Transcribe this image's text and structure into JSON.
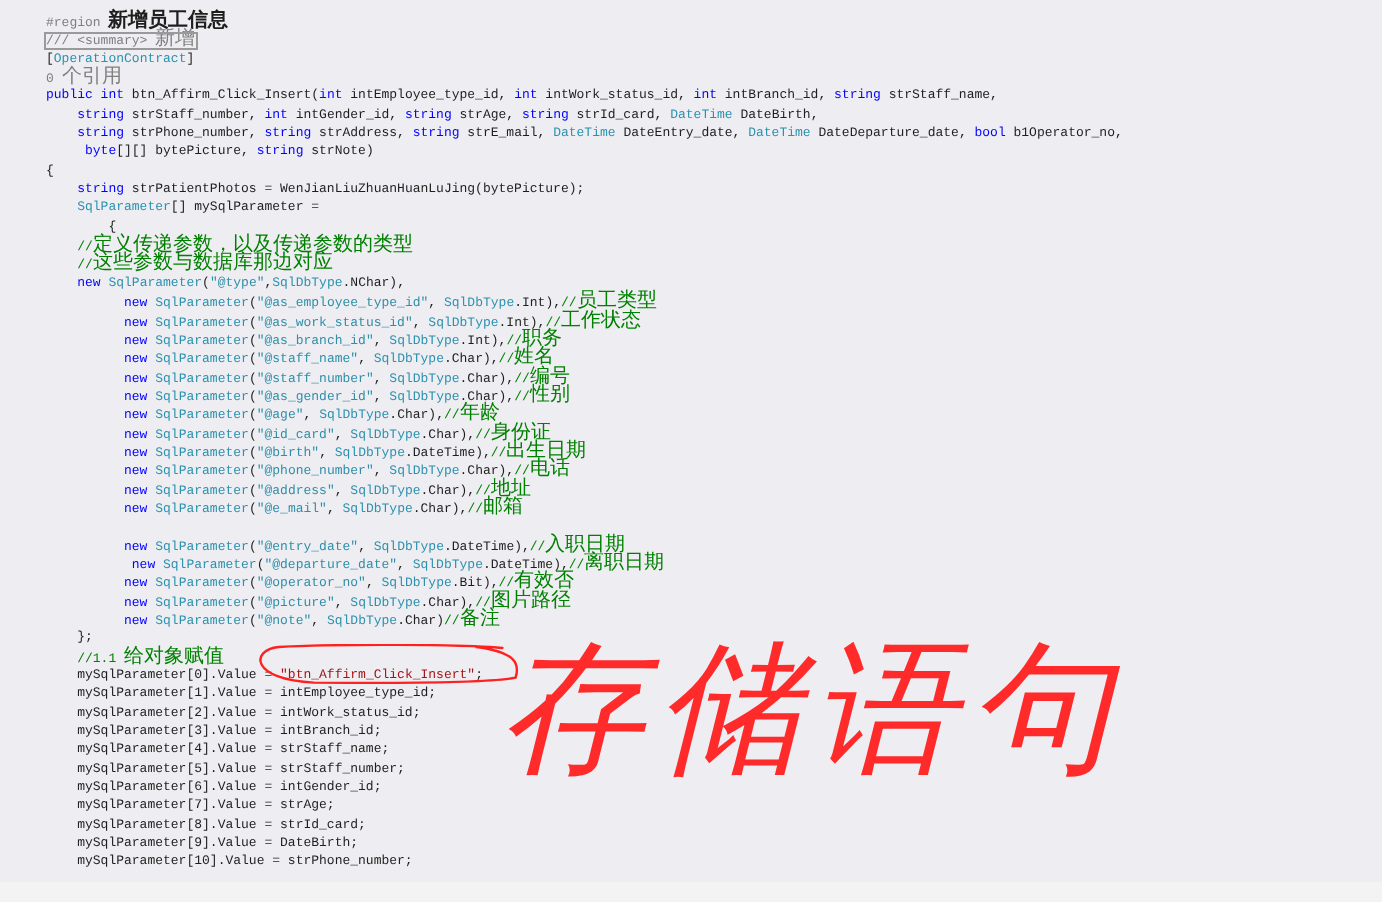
{
  "editor": {
    "lines": [
      {
        "kind": "code",
        "segments": [
          {
            "kind": "gray",
            "text": "#region"
          },
          {
            "kind": "region",
            "text": " 新增员工信息"
          }
        ]
      },
      {
        "kind": "code",
        "segments": [
          {
            "kind": "doc",
            "text": "/// <summary> 新增"
          }
        ]
      },
      {
        "kind": "code",
        "segments": [
          {
            "kind": "plain",
            "text": "["
          },
          {
            "kind": "type",
            "text": "OperationContract"
          },
          {
            "kind": "plain",
            "text": "]"
          }
        ]
      },
      {
        "kind": "code",
        "segments": [
          {
            "kind": "gray",
            "text": "0 个引用"
          }
        ]
      },
      {
        "kind": "code",
        "segments": [
          {
            "kind": "kw",
            "text": "public int"
          },
          {
            "kind": "plain",
            "text": " btn_Affirm_Click_Insert("
          },
          {
            "kind": "kw",
            "text": "int"
          },
          {
            "kind": "plain",
            "text": " intEmployee_type_id, "
          },
          {
            "kind": "kw",
            "text": "int"
          },
          {
            "kind": "plain",
            "text": " intWork_status_id, "
          },
          {
            "kind": "kw",
            "text": "int"
          },
          {
            "kind": "plain",
            "text": " intBranch_id, "
          },
          {
            "kind": "kw",
            "text": "string"
          },
          {
            "kind": "plain",
            "text": " strStaff_name,"
          }
        ]
      },
      {
        "kind": "code",
        "segments": [
          {
            "kind": "kw",
            "text": "    string"
          },
          {
            "kind": "plain",
            "text": " strStaff_number, "
          },
          {
            "kind": "kw",
            "text": "int"
          },
          {
            "kind": "plain",
            "text": " intGender_id, "
          },
          {
            "kind": "kw",
            "text": "string"
          },
          {
            "kind": "plain",
            "text": " strAge, "
          },
          {
            "kind": "kw",
            "text": "string"
          },
          {
            "kind": "plain",
            "text": " strId_card, "
          },
          {
            "kind": "type",
            "text": "DateTime"
          },
          {
            "kind": "plain",
            "text": " DateBirth,"
          }
        ]
      },
      {
        "kind": "code",
        "segments": [
          {
            "kind": "kw",
            "text": "    string"
          },
          {
            "kind": "plain",
            "text": " strPhone_number, "
          },
          {
            "kind": "kw",
            "text": "string"
          },
          {
            "kind": "plain",
            "text": " strAddress, "
          },
          {
            "kind": "kw",
            "text": "string"
          },
          {
            "kind": "plain",
            "text": " strE_mail, "
          },
          {
            "kind": "type",
            "text": "DateTime"
          },
          {
            "kind": "plain",
            "text": " DateEntry_date, "
          },
          {
            "kind": "type",
            "text": "DateTime"
          },
          {
            "kind": "plain",
            "text": " DateDeparture_date, "
          },
          {
            "kind": "kw",
            "text": "bool"
          },
          {
            "kind": "plain",
            "text": " b1Operator_no,"
          }
        ]
      },
      {
        "kind": "code",
        "segments": [
          {
            "kind": "kw",
            "text": "     byte"
          },
          {
            "kind": "plain",
            "text": "[][] bytePicture, "
          },
          {
            "kind": "kw",
            "text": "string"
          },
          {
            "kind": "plain",
            "text": " strNote)"
          }
        ]
      },
      {
        "kind": "code",
        "segments": [
          {
            "kind": "plain",
            "text": "{"
          }
        ]
      },
      {
        "kind": "code",
        "segments": [
          {
            "kind": "kw",
            "text": "    string"
          },
          {
            "kind": "plain",
            "text": " strPatientPhotos = WenJianLiuZhuanHuanLuJing(bytePicture);"
          }
        ]
      },
      {
        "kind": "code",
        "segments": [
          {
            "kind": "type",
            "text": "    SqlParameter"
          },
          {
            "kind": "plain",
            "text": "[] mySqlParameter ="
          }
        ]
      },
      {
        "kind": "code",
        "segments": [
          {
            "kind": "plain",
            "text": "        {"
          }
        ]
      },
      {
        "kind": "code",
        "segments": [
          {
            "kind": "comment",
            "text": "    //定义传递参数，以及传递参数的类型"
          }
        ]
      },
      {
        "kind": "code",
        "segments": [
          {
            "kind": "comment",
            "text": "    //这些参数与数据库那边对应"
          }
        ]
      },
      {
        "kind": "code",
        "segments": [
          {
            "kind": "kw",
            "text": "    new"
          },
          {
            "kind": "type",
            "text": " SqlParameter"
          },
          {
            "kind": "plain",
            "text": "("
          },
          {
            "kind": "param",
            "text": "\"@type\""
          },
          {
            "kind": "plain",
            "text": ","
          },
          {
            "kind": "type",
            "text": "SqlDbType"
          },
          {
            "kind": "plain",
            "text": ".NChar),"
          }
        ]
      },
      {
        "kind": "code",
        "segments": [
          {
            "kind": "kw",
            "text": "          new"
          },
          {
            "kind": "type",
            "text": " SqlParameter"
          },
          {
            "kind": "plain",
            "text": "("
          },
          {
            "kind": "param",
            "text": "\"@as_employee_type_id\""
          },
          {
            "kind": "plain",
            "text": ", "
          },
          {
            "kind": "type",
            "text": "SqlDbType"
          },
          {
            "kind": "plain",
            "text": ".Int),"
          },
          {
            "kind": "comment",
            "text": "//员工类型"
          }
        ]
      },
      {
        "kind": "code",
        "segments": [
          {
            "kind": "kw",
            "text": "          new"
          },
          {
            "kind": "type",
            "text": " SqlParameter"
          },
          {
            "kind": "plain",
            "text": "("
          },
          {
            "kind": "param",
            "text": "\"@as_work_status_id\""
          },
          {
            "kind": "plain",
            "text": ", "
          },
          {
            "kind": "type",
            "text": "SqlDbType"
          },
          {
            "kind": "plain",
            "text": ".Int),"
          },
          {
            "kind": "comment",
            "text": "//工作状态"
          }
        ]
      },
      {
        "kind": "code",
        "segments": [
          {
            "kind": "kw",
            "text": "          new"
          },
          {
            "kind": "type",
            "text": " SqlParameter"
          },
          {
            "kind": "plain",
            "text": "("
          },
          {
            "kind": "param",
            "text": "\"@as_branch_id\""
          },
          {
            "kind": "plain",
            "text": ", "
          },
          {
            "kind": "type",
            "text": "SqlDbType"
          },
          {
            "kind": "plain",
            "text": ".Int),"
          },
          {
            "kind": "comment",
            "text": "//职务"
          }
        ]
      },
      {
        "kind": "code",
        "segments": [
          {
            "kind": "kw",
            "text": "          new"
          },
          {
            "kind": "type",
            "text": " SqlParameter"
          },
          {
            "kind": "plain",
            "text": "("
          },
          {
            "kind": "param",
            "text": "\"@staff_name\""
          },
          {
            "kind": "plain",
            "text": ", "
          },
          {
            "kind": "type",
            "text": "SqlDbType"
          },
          {
            "kind": "plain",
            "text": ".Char),"
          },
          {
            "kind": "comment",
            "text": "//姓名"
          }
        ]
      },
      {
        "kind": "code",
        "segments": [
          {
            "kind": "kw",
            "text": "          new"
          },
          {
            "kind": "type",
            "text": " SqlParameter"
          },
          {
            "kind": "plain",
            "text": "("
          },
          {
            "kind": "param",
            "text": "\"@staff_number\""
          },
          {
            "kind": "plain",
            "text": ", "
          },
          {
            "kind": "type",
            "text": "SqlDbType"
          },
          {
            "kind": "plain",
            "text": ".Char),"
          },
          {
            "kind": "comment",
            "text": "//编号"
          }
        ]
      },
      {
        "kind": "code",
        "segments": [
          {
            "kind": "kw",
            "text": "          new"
          },
          {
            "kind": "type",
            "text": " SqlParameter"
          },
          {
            "kind": "plain",
            "text": "("
          },
          {
            "kind": "param",
            "text": "\"@as_gender_id\""
          },
          {
            "kind": "plain",
            "text": ", "
          },
          {
            "kind": "type",
            "text": "SqlDbType"
          },
          {
            "kind": "plain",
            "text": ".Char),"
          },
          {
            "kind": "comment",
            "text": "//性别"
          }
        ]
      },
      {
        "kind": "code",
        "segments": [
          {
            "kind": "kw",
            "text": "          new"
          },
          {
            "kind": "type",
            "text": " SqlParameter"
          },
          {
            "kind": "plain",
            "text": "("
          },
          {
            "kind": "param",
            "text": "\"@age\""
          },
          {
            "kind": "plain",
            "text": ", "
          },
          {
            "kind": "type",
            "text": "SqlDbType"
          },
          {
            "kind": "plain",
            "text": ".Char),"
          },
          {
            "kind": "comment",
            "text": "//年龄"
          }
        ]
      },
      {
        "kind": "code",
        "segments": [
          {
            "kind": "kw",
            "text": "          new"
          },
          {
            "kind": "type",
            "text": " SqlParameter"
          },
          {
            "kind": "plain",
            "text": "("
          },
          {
            "kind": "param",
            "text": "\"@id_card\""
          },
          {
            "kind": "plain",
            "text": ", "
          },
          {
            "kind": "type",
            "text": "SqlDbType"
          },
          {
            "kind": "plain",
            "text": ".Char),"
          },
          {
            "kind": "comment",
            "text": "//身份证"
          }
        ]
      },
      {
        "kind": "code",
        "segments": [
          {
            "kind": "kw",
            "text": "          new"
          },
          {
            "kind": "type",
            "text": " SqlParameter"
          },
          {
            "kind": "plain",
            "text": "("
          },
          {
            "kind": "param",
            "text": "\"@birth\""
          },
          {
            "kind": "plain",
            "text": ", "
          },
          {
            "kind": "type",
            "text": "SqlDbType"
          },
          {
            "kind": "plain",
            "text": ".DateTime),"
          },
          {
            "kind": "comment",
            "text": "//出生日期"
          }
        ]
      },
      {
        "kind": "code",
        "segments": [
          {
            "kind": "kw",
            "text": "          new"
          },
          {
            "kind": "type",
            "text": " SqlParameter"
          },
          {
            "kind": "plain",
            "text": "("
          },
          {
            "kind": "param",
            "text": "\"@phone_number\""
          },
          {
            "kind": "plain",
            "text": ", "
          },
          {
            "kind": "type",
            "text": "SqlDbType"
          },
          {
            "kind": "plain",
            "text": ".Char),"
          },
          {
            "kind": "comment",
            "text": "//电话"
          }
        ]
      },
      {
        "kind": "code",
        "segments": [
          {
            "kind": "kw",
            "text": "          new"
          },
          {
            "kind": "type",
            "text": " SqlParameter"
          },
          {
            "kind": "plain",
            "text": "("
          },
          {
            "kind": "param",
            "text": "\"@address\""
          },
          {
            "kind": "plain",
            "text": ", "
          },
          {
            "kind": "type",
            "text": "SqlDbType"
          },
          {
            "kind": "plain",
            "text": ".Char),"
          },
          {
            "kind": "comment",
            "text": "//地址"
          }
        ]
      },
      {
        "kind": "code",
        "segments": [
          {
            "kind": "kw",
            "text": "          new"
          },
          {
            "kind": "type",
            "text": " SqlParameter"
          },
          {
            "kind": "plain",
            "text": "("
          },
          {
            "kind": "param",
            "text": "\"@e_mail\""
          },
          {
            "kind": "plain",
            "text": ", "
          },
          {
            "kind": "type",
            "text": "SqlDbType"
          },
          {
            "kind": "plain",
            "text": ".Char),"
          },
          {
            "kind": "comment",
            "text": "//邮箱"
          }
        ]
      },
      {
        "kind": "blank"
      },
      {
        "kind": "code",
        "segments": [
          {
            "kind": "kw",
            "text": "          new"
          },
          {
            "kind": "type",
            "text": " SqlParameter"
          },
          {
            "kind": "plain",
            "text": "("
          },
          {
            "kind": "param",
            "text": "\"@entry_date\""
          },
          {
            "kind": "plain",
            "text": ", "
          },
          {
            "kind": "type",
            "text": "SqlDbType"
          },
          {
            "kind": "plain",
            "text": ".DateTime),"
          },
          {
            "kind": "comment",
            "text": "//入职日期"
          }
        ]
      },
      {
        "kind": "code",
        "segments": [
          {
            "kind": "kw",
            "text": "           new"
          },
          {
            "kind": "type",
            "text": " SqlParameter"
          },
          {
            "kind": "plain",
            "text": "("
          },
          {
            "kind": "param",
            "text": "\"@departure_date\""
          },
          {
            "kind": "plain",
            "text": ", "
          },
          {
            "kind": "type",
            "text": "SqlDbType"
          },
          {
            "kind": "plain",
            "text": ".DateTime),"
          },
          {
            "kind": "comment",
            "text": "//离职日期"
          }
        ]
      },
      {
        "kind": "code",
        "segments": [
          {
            "kind": "kw",
            "text": "          new"
          },
          {
            "kind": "type",
            "text": " SqlParameter"
          },
          {
            "kind": "plain",
            "text": "("
          },
          {
            "kind": "param",
            "text": "\"@operator_no\""
          },
          {
            "kind": "plain",
            "text": ", "
          },
          {
            "kind": "type",
            "text": "SqlDbType"
          },
          {
            "kind": "plain",
            "text": ".Bit),"
          },
          {
            "kind": "comment",
            "text": "//有效否"
          }
        ]
      },
      {
        "kind": "code",
        "segments": [
          {
            "kind": "kw",
            "text": "          new"
          },
          {
            "kind": "type",
            "text": " SqlParameter"
          },
          {
            "kind": "plain",
            "text": "("
          },
          {
            "kind": "param",
            "text": "\"@picture\""
          },
          {
            "kind": "plain",
            "text": ", "
          },
          {
            "kind": "type",
            "text": "SqlDbType"
          },
          {
            "kind": "plain",
            "text": ".Char),"
          },
          {
            "kind": "comment",
            "text": "//图片路径"
          }
        ]
      },
      {
        "kind": "code",
        "segments": [
          {
            "kind": "kw",
            "text": "          new"
          },
          {
            "kind": "type",
            "text": " SqlParameter"
          },
          {
            "kind": "plain",
            "text": "("
          },
          {
            "kind": "param",
            "text": "\"@note\""
          },
          {
            "kind": "plain",
            "text": ", "
          },
          {
            "kind": "type",
            "text": "SqlDbType"
          },
          {
            "kind": "plain",
            "text": ".Char)"
          },
          {
            "kind": "comment",
            "text": "//备注"
          }
        ]
      },
      {
        "kind": "code",
        "segments": [
          {
            "kind": "plain",
            "text": "    };"
          }
        ]
      },
      {
        "kind": "code",
        "segments": [
          {
            "kind": "comment",
            "text": "    //1.1 给对象赋值"
          }
        ]
      },
      {
        "kind": "code",
        "segments": [
          {
            "kind": "plain",
            "text": "    mySqlParameter[0].Value = "
          },
          {
            "kind": "str",
            "text": "\"btn_Affirm_Click_Insert\""
          },
          {
            "kind": "plain",
            "text": ";"
          }
        ]
      },
      {
        "kind": "code",
        "segments": [
          {
            "kind": "plain",
            "text": "    mySqlParameter[1].Value = intEmployee_type_id;"
          }
        ]
      },
      {
        "kind": "code",
        "segments": [
          {
            "kind": "plain",
            "text": "    mySqlParameter[2].Value = intWork_status_id;"
          }
        ]
      },
      {
        "kind": "code",
        "segments": [
          {
            "kind": "plain",
            "text": "    mySqlParameter[3].Value = intBranch_id;"
          }
        ]
      },
      {
        "kind": "code",
        "segments": [
          {
            "kind": "plain",
            "text": "    mySqlParameter[4].Value = strStaff_name;"
          }
        ]
      },
      {
        "kind": "code",
        "segments": [
          {
            "kind": "plain",
            "text": "    mySqlParameter[5].Value = strStaff_number;"
          }
        ]
      },
      {
        "kind": "code",
        "segments": [
          {
            "kind": "plain",
            "text": "    mySqlParameter[6].Value = intGender_id;"
          }
        ]
      },
      {
        "kind": "code",
        "segments": [
          {
            "kind": "plain",
            "text": "    mySqlParameter[7].Value = strAge;"
          }
        ]
      },
      {
        "kind": "code",
        "segments": [
          {
            "kind": "plain",
            "text": "    mySqlParameter[8].Value = strId_card;"
          }
        ]
      },
      {
        "kind": "code",
        "segments": [
          {
            "kind": "plain",
            "text": "    mySqlParameter[9].Value = DateBirth;"
          }
        ]
      },
      {
        "kind": "code",
        "segments": [
          {
            "kind": "plain",
            "text": "    mySqlParameter[10].Value = strPhone_number;"
          }
        ]
      }
    ]
  },
  "annotation": {
    "text": "存储语句"
  }
}
